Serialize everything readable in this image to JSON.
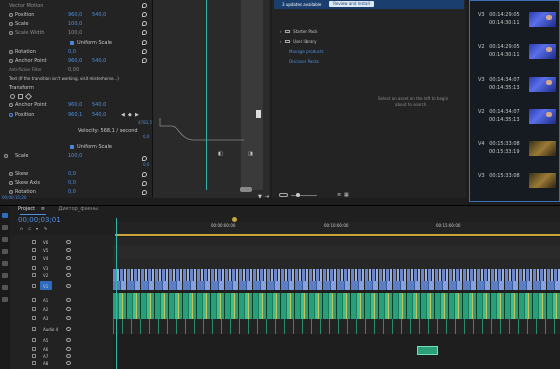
{
  "effect_controls": {
    "rows": [
      {
        "label": "Vector Motion",
        "v1": "",
        "v2": ""
      },
      {
        "label": "Position",
        "v1": "960,0",
        "v2": "540,0"
      },
      {
        "label": "Scale",
        "v1": "100,0",
        "v2": ""
      },
      {
        "label": "Scale Width",
        "v1": "100,0",
        "v2": ""
      },
      {
        "label": "Uniform Scale",
        "v1": "",
        "v2": ""
      },
      {
        "label": "Rotation",
        "v1": "0,0",
        "v2": ""
      },
      {
        "label": "Anchor Point",
        "v1": "960,0",
        "v2": "540,0"
      },
      {
        "label": "Anti-flicker Filter",
        "v1": "0,00",
        "v2": ""
      },
      {
        "label": "Text (If the transition isn't working, visit misterhorse...)",
        "v1": "",
        "v2": ""
      },
      {
        "label": "Transform",
        "v1": "",
        "v2": ""
      },
      {
        "label": "Anchor Point",
        "v1": "960,0",
        "v2": "540,0"
      },
      {
        "label": "Position",
        "v1": "960,1",
        "v2": "540,0"
      }
    ],
    "velocity": "Velocity: 568,1 / second",
    "graph_top": "4783,5",
    "graph_zero": "0,0",
    "graph_mid": "0,0",
    "rows2": [
      {
        "label": "Uniform Scale",
        "v1": "",
        "v2": ""
      },
      {
        "label": "Scale",
        "v1": "100,0",
        "v2": ""
      },
      {
        "label": "",
        "v1": "0",
        "v2": "100,0"
      },
      {
        "label": "Skew",
        "v1": "0,0",
        "v2": ""
      },
      {
        "label": "Skew Axis",
        "v1": "0,0",
        "v2": ""
      },
      {
        "label": "Rotation",
        "v1": "0,0",
        "v2": ""
      }
    ],
    "timecode": "00;00;15;20"
  },
  "libraries": {
    "banner_text": "3 updates available",
    "review_button": "Review and Install",
    "items": [
      "Starter Pack",
      "User library",
      "Manage products",
      "Discover Packs"
    ],
    "empty_hint_line1": "Select an asset on the left to begin",
    "empty_hint_line2": "about to search."
  },
  "media": {
    "clips": [
      {
        "name": "V3",
        "in": "00:14:29:05",
        "out": "00:14:30:11"
      },
      {
        "name": "V2",
        "in": "00:14:29:05",
        "out": "00:14:30:11"
      },
      {
        "name": "V3",
        "in": "00:14:34:07",
        "out": "00:14:35:13"
      },
      {
        "name": "V2",
        "in": "00:14:34:07",
        "out": "00:14:35:13"
      },
      {
        "name": "V4",
        "in": "00:15:33:08",
        "out": "00:15:33:19"
      },
      {
        "name": "V3",
        "in": "00:15:33:08",
        "out": ""
      }
    ]
  },
  "timeline": {
    "tabs": [
      "Project",
      "Диктор_фаены"
    ],
    "timecode": "00;00;03;01",
    "ruler": [
      "00:00:00:00",
      "00:10:00:00",
      "00:15:00:00"
    ],
    "tracks": [
      "V6",
      "V5",
      "V4",
      "V3",
      "V2",
      "V1",
      "A1",
      "A2",
      "A3",
      "Audio 4",
      "A5",
      "A6",
      "A7",
      "A8"
    ]
  },
  "colors": {
    "accent": "#4f8fe0",
    "playhead": "#2fb5a8",
    "banner": "#1a3f6f",
    "audio_clip": "#27a07a",
    "video_clip": "#5b7fc7"
  }
}
